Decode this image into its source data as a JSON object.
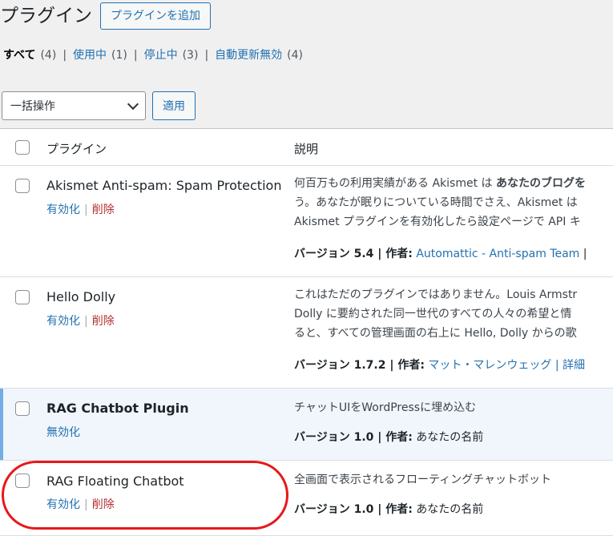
{
  "header": {
    "title": "プラグイン",
    "add_button": "プラグインを追加"
  },
  "filters": [
    {
      "label": "すべて",
      "count": "(4)"
    },
    {
      "label": "使用中",
      "count": "(1)"
    },
    {
      "label": "停止中",
      "count": "(3)"
    },
    {
      "label": "自動更新無効",
      "count": "(4)"
    }
  ],
  "bulk": {
    "selected": "一括操作",
    "apply": "適用"
  },
  "table": {
    "col_plugin": "プラグイン",
    "col_desc": "説明"
  },
  "plugins": [
    {
      "name": "Akismet Anti-spam: Spam Protection",
      "action1": "有効化",
      "action2": "削除",
      "desc1": "何百万もの利用実績がある Akismet は",
      "desc1_bold": "あなたのブログを",
      "desc2": "う。あなたが眠りについている時間でさえ、Akismet は",
      "desc3": "Akismet プラグインを有効化したら設定ページで API キ",
      "version_label": "バージョン 5.4 | 作者:",
      "author": "Automattic - Anti-spam Team",
      "after_author": " |"
    },
    {
      "name": "Hello Dolly",
      "action1": "有効化",
      "action2": "削除",
      "desc1": "これはただのプラグインではありません。Louis Armstr",
      "desc2": "Dolly に要約された同一世代のすべての人々の希望と情",
      "desc3": "ると、すべての管理画面の右上に Hello, Dolly からの歌",
      "version_label": "バージョン 1.7.2 | 作者:",
      "author": "マット・マレンウェッグ",
      "after_author": " | 詳細"
    },
    {
      "name": "RAG Chatbot Plugin",
      "action1": "無効化",
      "desc1": "チャットUIをWordPressに埋め込む",
      "version_label": "バージョン 1.0 | 作者:",
      "author_plain": " あなたの名前"
    },
    {
      "name": "RAG Floating Chatbot",
      "action1": "有効化",
      "action2": "削除",
      "desc1": "全画面で表示されるフローティングチャットボット",
      "version_label": "バージョン 1.0 | 作者:",
      "author_plain": " あなたの名前"
    }
  ],
  "colors": {
    "link": "#2271b1",
    "delete": "#b32d2e",
    "active_stripe": "#72aee6",
    "annotation": "#e8171b"
  }
}
